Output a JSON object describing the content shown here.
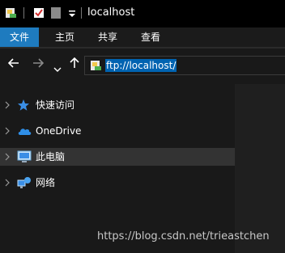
{
  "window": {
    "title": "localhost"
  },
  "ribbon": {
    "tabs": [
      "文件",
      "主页",
      "共享",
      "查看"
    ],
    "active_tab": "文件"
  },
  "navigation": {
    "address": "ftp://localhost/"
  },
  "sidebar": {
    "items": [
      {
        "label": "快速访问",
        "icon": "star-icon",
        "selected": false
      },
      {
        "label": "OneDrive",
        "icon": "cloud-icon",
        "selected": false
      },
      {
        "label": "此电脑",
        "icon": "computer-icon",
        "selected": true
      },
      {
        "label": "网络",
        "icon": "network-icon",
        "selected": false
      }
    ]
  },
  "watermark": "https://blog.csdn.net/trieastchen",
  "colors": {
    "accent": "#1e7bbf",
    "selection": "#0063b1",
    "background": "#191919"
  }
}
